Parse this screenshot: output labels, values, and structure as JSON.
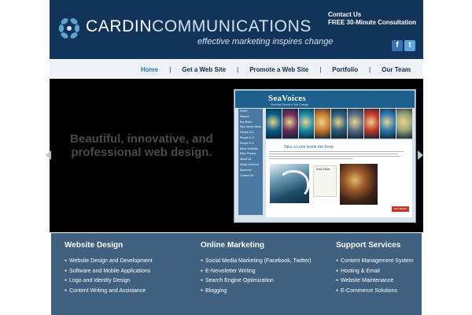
{
  "header": {
    "brand_bold": "CARDIN",
    "brand_light": "COMMUNICATIONS",
    "tagline": "effective marketing inspires change",
    "contact_line1": "Contact Us",
    "contact_line2": "FREE 30-Minute Consultation",
    "social": [
      {
        "icon": "facebook-icon",
        "glyph": "f"
      },
      {
        "icon": "twitter-icon",
        "glyph": "t"
      }
    ]
  },
  "nav": {
    "items": [
      {
        "label": "Home",
        "active": true
      },
      {
        "label": "Get a Web Site"
      },
      {
        "label": "Promote a Web Site"
      },
      {
        "label": "Portfolio"
      },
      {
        "label": "Our Team"
      }
    ],
    "separator": "|"
  },
  "hero": {
    "text": "Beautiful, innovative, and professional web design.",
    "preview": {
      "site_name": "SeaVoices",
      "site_tagline": "Working Toward a Sea Change",
      "menu": [
        "Home",
        "Abacus",
        "Buy Book",
        "Sea Voices Store",
        "People A-G",
        "People H-O",
        "People P-Z",
        "News & Media",
        "Misc. Photos",
        "About Us",
        "Adopt a School",
        "Sponsors",
        "Contact Us"
      ],
      "heading": "Take a Look Inside the Book",
      "book_title": "Kelly Slater",
      "buy_label": "BUY BOOK NOW",
      "photo_colors": [
        "#0b5f8c",
        "#6a2e5f",
        "#1d8aa8",
        "#c87a2a",
        "#2d5d7a",
        "#5a6f86",
        "#c8392a",
        "#2e7bb0",
        "#9aa57a"
      ]
    },
    "arrow_color": "#bfc3c7"
  },
  "services": {
    "columns": [
      {
        "title": "Website Design",
        "items": [
          "Website Design and Development",
          "Software and Mobile Applications",
          "Logo and Identity Design",
          "Content Writing and Assistance"
        ]
      },
      {
        "title": "Online Marketing",
        "items": [
          "Social Media Marketing (Facebook, Twitter)",
          "E-Newsletter Writing",
          "Search Engine Optimization",
          "Blogging"
        ]
      },
      {
        "title": "Support Services",
        "items": [
          "Content Management System",
          "Hosting & Email",
          "Website Maintenance",
          "E-Commerce Solutions"
        ]
      }
    ]
  },
  "colors": {
    "header_bg": "#12335a",
    "nav_active": "#2f78c2",
    "services_bg": "#3f607f"
  }
}
